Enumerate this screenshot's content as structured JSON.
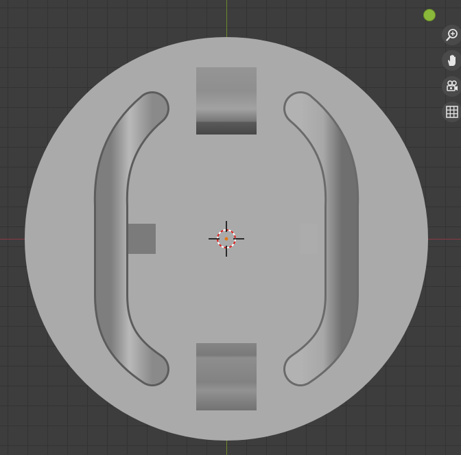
{
  "viewport": {
    "background_color": "#3d3d3d",
    "grid_color": "#333333",
    "x_axis_color": "#8a3a44",
    "y_axis_color": "#6b8a2a"
  },
  "object": {
    "disc_color": "#aaaaaa",
    "handle_color": "#a3a3a3"
  },
  "navigation_gizmo": {
    "z_axis_color": "#8ab83a",
    "buttons": [
      {
        "icon": "zoom-icon"
      },
      {
        "icon": "pan-hand-icon"
      },
      {
        "icon": "camera-view-icon"
      },
      {
        "icon": "grid-view-icon"
      }
    ]
  }
}
